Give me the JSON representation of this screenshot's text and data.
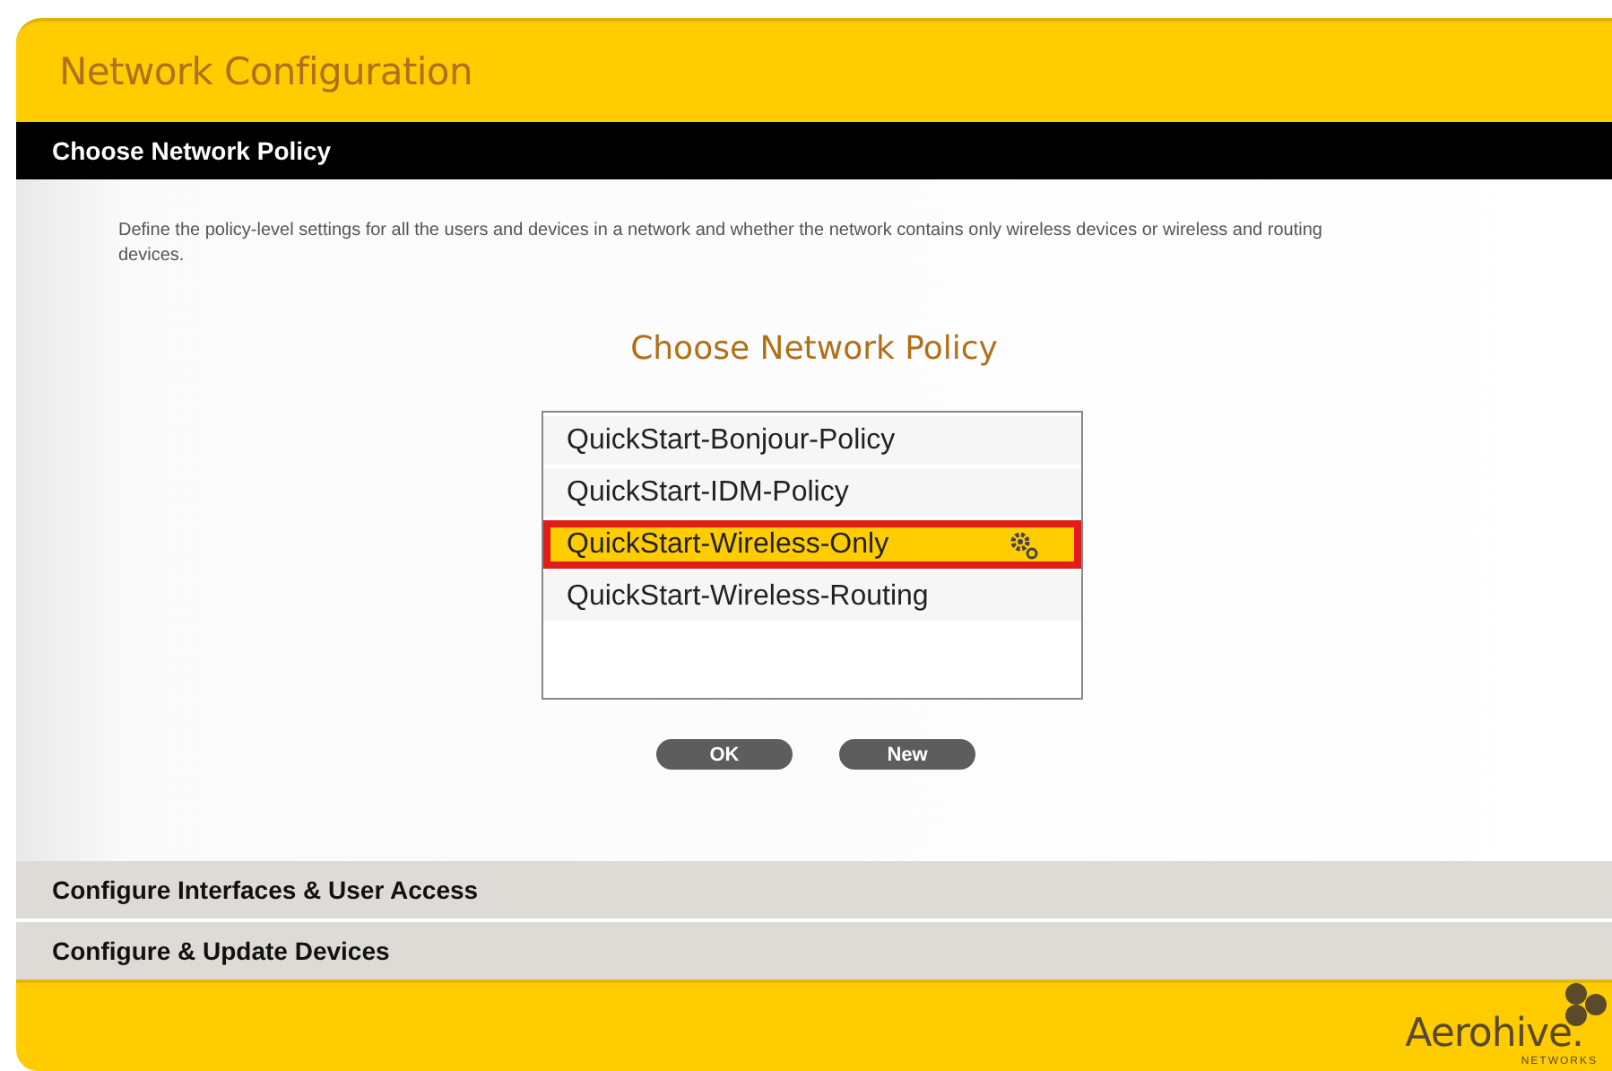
{
  "window": {
    "title": "Network Configuration"
  },
  "section": {
    "title": "Choose Network Policy",
    "expanded": true
  },
  "description": "Define the policy-level settings for all the users and devices in a network and whether the network contains only wireless devices or wireless and routing devices.",
  "policy_picker": {
    "heading": "Choose Network Policy",
    "items": [
      {
        "label": "QuickStart-Bonjour-Policy",
        "selected": false
      },
      {
        "label": "QuickStart-IDM-Policy",
        "selected": false
      },
      {
        "label": "QuickStart-Wireless-Only",
        "selected": true
      },
      {
        "label": "QuickStart-Wireless-Routing",
        "selected": false
      }
    ],
    "buttons": [
      "OK",
      "New"
    ]
  },
  "steps": [
    {
      "title": "Configure Interfaces & User Access",
      "expanded": false
    },
    {
      "title": "Configure & Update Devices",
      "expanded": false
    }
  ],
  "logo": {
    "name": "Aerohive.",
    "tagline": "NETWORKS"
  }
}
